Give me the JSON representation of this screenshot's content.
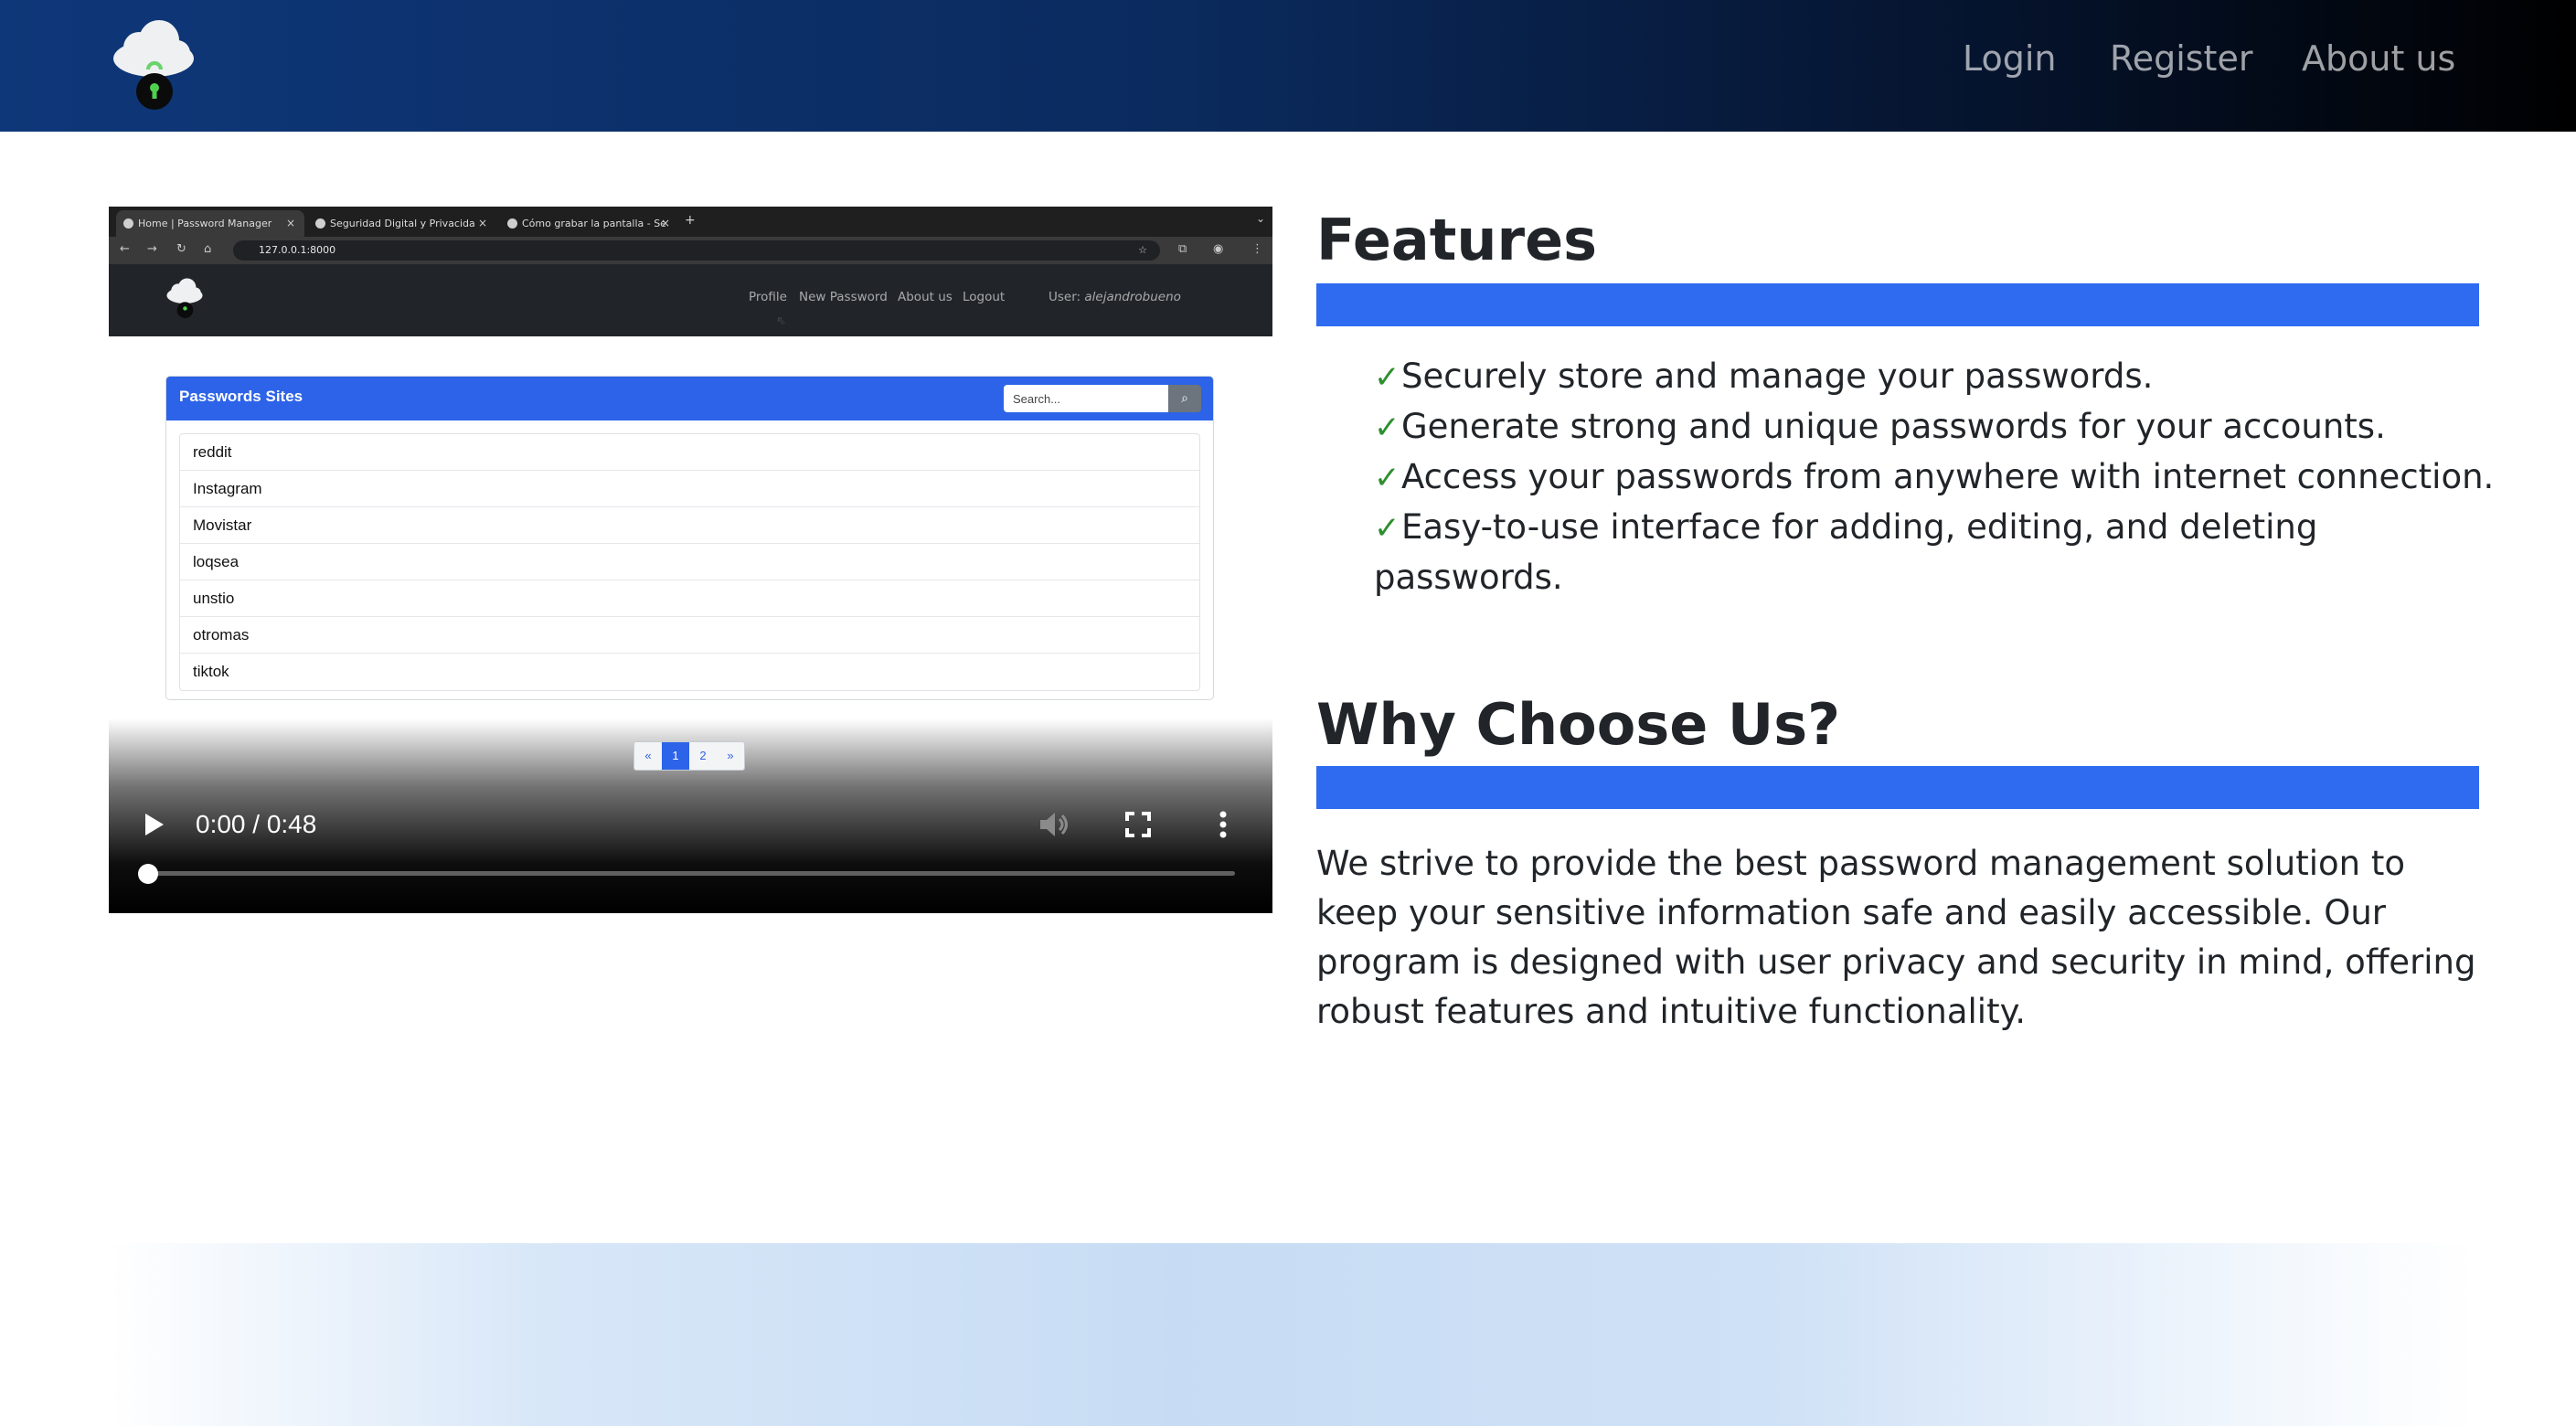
{
  "navbar": {
    "logo_icon": "cloud-lock-icon",
    "links": [
      "Login",
      "Register",
      "About us"
    ],
    "gradient_colors": [
      "#0e3779",
      "#000000"
    ]
  },
  "video": {
    "browser": {
      "tabs": [
        "Home | Password Manager",
        "Seguridad Digital y Privacida",
        "Cómo grabar la pantalla - Se"
      ],
      "url": "127.0.0.1:8000"
    },
    "inner_nav": {
      "links": [
        "Profile",
        "New Password",
        "About us",
        "Logout"
      ],
      "user_label": "User:",
      "user_name": "alejandrobueno"
    },
    "passwords_card": {
      "title": "Passwords Sites",
      "search_placeholder": "Search...",
      "items": [
        "reddit",
        "Instagram",
        "Movistar",
        "loqsea",
        "unstio",
        "otromas",
        "tiktok"
      ],
      "pager": [
        "«",
        "1",
        "2",
        "»"
      ],
      "active_page": "1"
    },
    "controls": {
      "time": "0:00 / 0:48",
      "progress": 0
    }
  },
  "features": {
    "title": "Features",
    "items": [
      "Securely store and manage your passwords.",
      "Generate strong and unique passwords for your accounts.",
      "Access your passwords from anywhere with internet connection.",
      "Easy-to-use interface for adding, editing, and deleting passwords."
    ],
    "check_icon": "check-icon",
    "accent_color": "#2f6bf1"
  },
  "why": {
    "title": "Why Choose Us?",
    "text": "We strive to provide the best password management solution to keep your sensitive information safe and easily accessible. Our program is designed with user privacy and security in mind, offering robust features and intuitive functionality."
  }
}
